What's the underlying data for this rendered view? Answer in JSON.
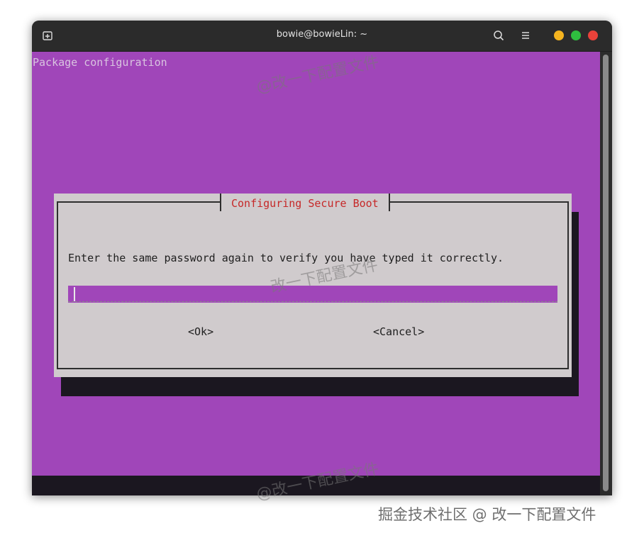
{
  "window": {
    "title": "bowie@bowieLin: ~",
    "icons": {
      "new_tab": "new-tab-icon",
      "search": "search-icon",
      "menu": "hamburger-menu-icon"
    },
    "controls": {
      "minimize_color": "#f5b41f",
      "maximize_color": "#2fbe3f",
      "close_color": "#e9423a"
    }
  },
  "terminal": {
    "background_color": "#a046b9",
    "header_text": "Package configuration"
  },
  "dialog": {
    "title": "Configuring Secure Boot",
    "title_color": "#c62828",
    "message": "Enter the same password again to verify you have typed it correctly.",
    "password_value": "",
    "ok_label": "<Ok>",
    "cancel_label": "<Cancel>"
  },
  "watermarks": {
    "top": "@改一下配置文件",
    "middle": "改一下配置文件",
    "bottom": "@改一下配置文件",
    "footer": "掘金技术社区 @ 改一下配置文件"
  }
}
